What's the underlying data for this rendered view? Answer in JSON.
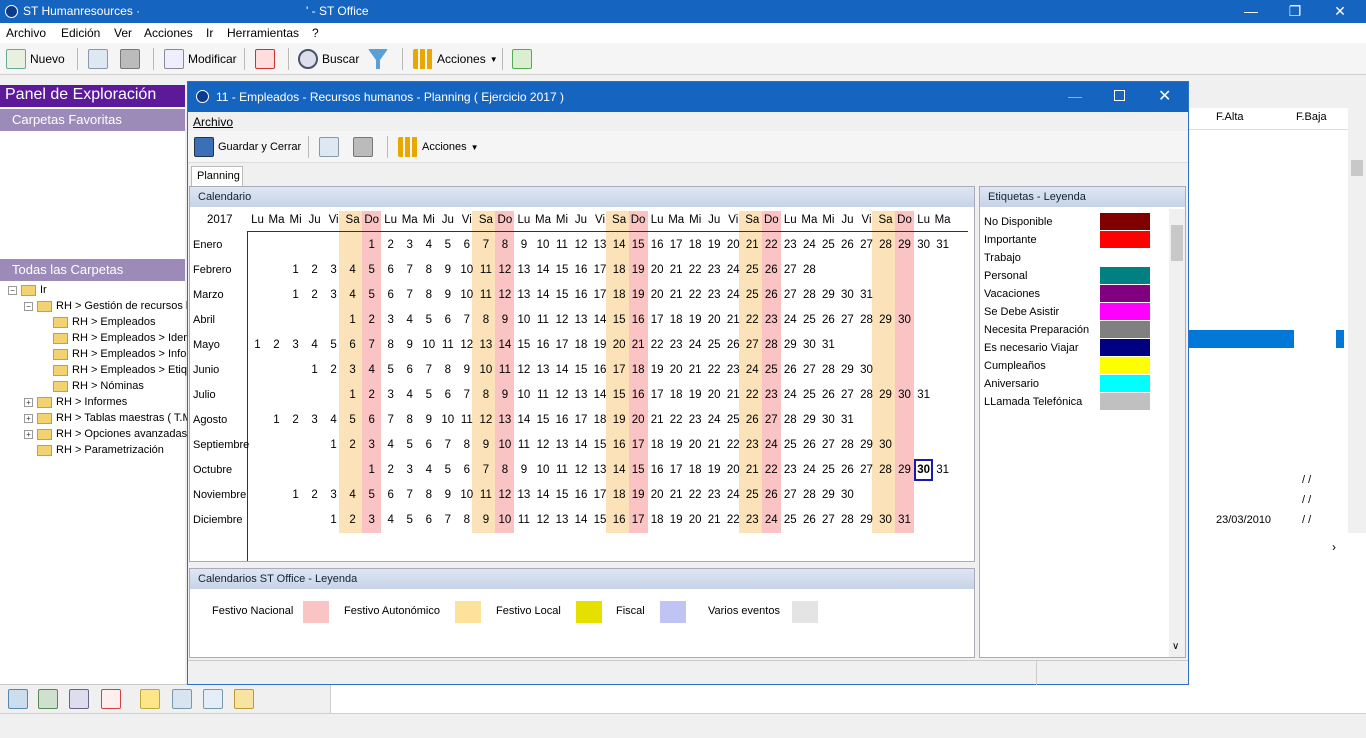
{
  "app": {
    "title_left": "ST Humanresources ·",
    "title_right": "' - ST Office",
    "controls": [
      "—",
      "❐",
      "✕"
    ]
  },
  "menu": [
    "Archivo",
    "Edición",
    "Ver",
    "Acciones",
    "Ir",
    "Herramientas",
    "?"
  ],
  "toolbar": {
    "nuevo": "Nuevo",
    "modificar": "Modificar",
    "buscar": "Buscar",
    "acciones": "Acciones"
  },
  "panel": {
    "title": "Panel de Exploración",
    "favoritas": "Carpetas Favoritas",
    "todas": "Todas las Carpetas",
    "tree": [
      "Ir",
      "RH > Gestión de recursos h",
      "RH > Empleados",
      "RH > Empleados > Iden",
      "RH > Empleados > Info",
      "RH > Empleados > Etiq",
      "RH > Nóminas",
      "RH > Informes",
      "RH > Tablas maestras ( T.M",
      "RH > Opciones avanzadas",
      "RH > Parametrización"
    ]
  },
  "bg_table": {
    "col_alta": "F.Alta",
    "col_baja": "F.Baja",
    "baja_vals": [
      "/ /",
      "/ /",
      "/ /"
    ],
    "alta_last": "23/03/2010"
  },
  "dialog": {
    "title": "11 - Empleados - Recursos humanos - Planning ( Ejercicio 2017 )",
    "menu": "Archivo",
    "guardar": "Guardar y Cerrar",
    "acciones": "Acciones",
    "tab": "Planning",
    "cal_header": "Calendario",
    "year": "2017",
    "legend_header": "Etiquetas - Leyenda",
    "bottom_header": "Calendarios ST Office - Leyenda"
  },
  "weekdays": [
    "Lu",
    "Ma",
    "Mi",
    "Ju",
    "Vi",
    "Sa",
    "Do",
    "Lu",
    "Ma",
    "Mi",
    "Ju",
    "Vi",
    "Sa",
    "Do",
    "Lu",
    "Ma",
    "Mi",
    "Ju",
    "Vi",
    "Sa",
    "Do",
    "Lu",
    "Ma",
    "Mi",
    "Ju",
    "Vi",
    "Sa",
    "Do",
    "Lu",
    "Ma",
    "Mi",
    "Ju",
    "Vi",
    "Sa",
    "Do",
    "Lu",
    "Ma"
  ],
  "months": [
    {
      "name": "Enero",
      "start": 6,
      "days": 31
    },
    {
      "name": "Febrero",
      "start": 2,
      "days": 28
    },
    {
      "name": "Marzo",
      "start": 2,
      "days": 31
    },
    {
      "name": "Abril",
      "start": 5,
      "days": 30
    },
    {
      "name": "Mayo",
      "start": 0,
      "days": 31
    },
    {
      "name": "Junio",
      "start": 3,
      "days": 30
    },
    {
      "name": "Julio",
      "start": 5,
      "days": 31
    },
    {
      "name": "Agosto",
      "start": 1,
      "days": 31
    },
    {
      "name": "Septiembre",
      "start": 4,
      "days": 30
    },
    {
      "name": "Octubre",
      "start": 6,
      "days": 31
    },
    {
      "name": "Noviembre",
      "start": 2,
      "days": 30
    },
    {
      "name": "Diciembre",
      "start": 4,
      "days": 31
    }
  ],
  "selected": {
    "month": "Octubre",
    "day": 30
  },
  "labels": [
    {
      "name": "No Disponible",
      "color": "#800000"
    },
    {
      "name": "Importante",
      "color": "#ff0000"
    },
    {
      "name": "Trabajo",
      "color": ""
    },
    {
      "name": "Personal",
      "color": "#008080"
    },
    {
      "name": "Vacaciones",
      "color": "#800080"
    },
    {
      "name": "Se Debe Asistir",
      "color": "#ff00ff"
    },
    {
      "name": "Necesita Preparación",
      "color": "#808080"
    },
    {
      "name": "Es necesario Viajar",
      "color": "#000080"
    },
    {
      "name": "Cumpleaños",
      "color": "#ffff00"
    },
    {
      "name": "Aniversario",
      "color": "#00ffff"
    },
    {
      "name": "LLamada Telefónica",
      "color": "#c0c0c0"
    }
  ],
  "holiday_legend": [
    {
      "name": "Festivo Nacional",
      "color": "#fbc4c4"
    },
    {
      "name": "Festivo Autonómico",
      "color": "#fce29a"
    },
    {
      "name": "Festivo Local",
      "color": "#e6e000"
    },
    {
      "name": "Fiscal",
      "color": "#c0c4f4"
    },
    {
      "name": "Varios eventos",
      "color": "#e4e4e4"
    }
  ]
}
